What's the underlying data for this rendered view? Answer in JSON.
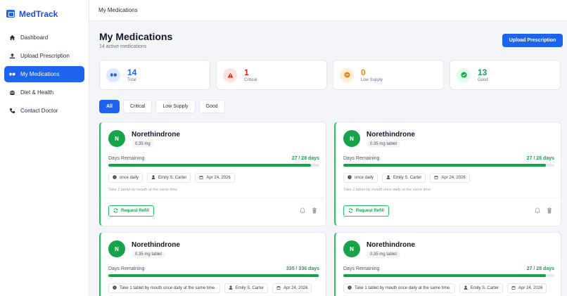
{
  "app": {
    "name": "MedTrack"
  },
  "sidebar": {
    "items": [
      {
        "label": "Dashboard",
        "icon": "home-icon",
        "active": false
      },
      {
        "label": "Upload Prescription",
        "icon": "upload-icon",
        "active": false
      },
      {
        "label": "My Medications",
        "icon": "pills-icon",
        "active": true
      },
      {
        "label": "Diet & Health",
        "icon": "food-icon",
        "active": false
      },
      {
        "label": "Contact Doctor",
        "icon": "phone-icon",
        "active": false
      }
    ]
  },
  "topbar": {
    "title": "My Medications"
  },
  "page": {
    "title": "My Medications",
    "subtitle": "14 active medications",
    "upload_label": "Upload Prescription"
  },
  "stats": [
    {
      "value": "14",
      "label": "Total",
      "color": "#2563eb",
      "icon": "pills-icon"
    },
    {
      "value": "1",
      "label": "Critical",
      "color": "#dc2626",
      "icon": "warning-icon"
    },
    {
      "value": "0",
      "label": "Low Supply",
      "color": "#ea8a0c",
      "icon": "minus-circle-icon"
    },
    {
      "value": "13",
      "label": "Good",
      "color": "#16a34a",
      "icon": "check-circle-icon"
    }
  ],
  "filters": [
    "All",
    "Critical",
    "Low Supply",
    "Good"
  ],
  "cards": [
    {
      "initial": "N",
      "name": "Norethindrone",
      "dose": "0.35 mg",
      "days_label": "Days Remaining",
      "days": "27 / 28 days",
      "progress": 0.96,
      "frequency": "once daily",
      "doctor": "Emily S. Carter",
      "date": "Apr 24, 2026",
      "instructions": "Take 1 tablet by mouth at the same time.",
      "refill_label": "Request Refill"
    },
    {
      "initial": "N",
      "name": "Norethindrone",
      "dose": "0.35 mg tablet",
      "days_label": "Days Remaining",
      "days": "27 / 28 days",
      "progress": 0.96,
      "frequency": "once daily",
      "doctor": "Emily S. Carter",
      "date": "Apr 24, 2026",
      "instructions": "Take 1 tablet by mouth once daily at the same time.",
      "refill_label": "Request Refill"
    },
    {
      "initial": "N",
      "name": "Norethindrone",
      "dose": "0.35 mg tablet",
      "days_label": "Days Remaining",
      "days": "335 / 336 days",
      "progress": 0.997,
      "frequency": "Take 1 tablet by mouth once daily at the same time.",
      "doctor": "Emily S. Carter",
      "date": "Apr 24, 2026"
    },
    {
      "initial": "N",
      "name": "Norethindrone",
      "dose": "0.35 mg tablet",
      "days_label": "Days Remaining",
      "days": "27 / 28 days",
      "progress": 0.96,
      "frequency": "Take 1 tablet by mouth once daily at the same time.",
      "doctor": "Emily S. Carter",
      "date": "Apr 24, 2026"
    }
  ]
}
